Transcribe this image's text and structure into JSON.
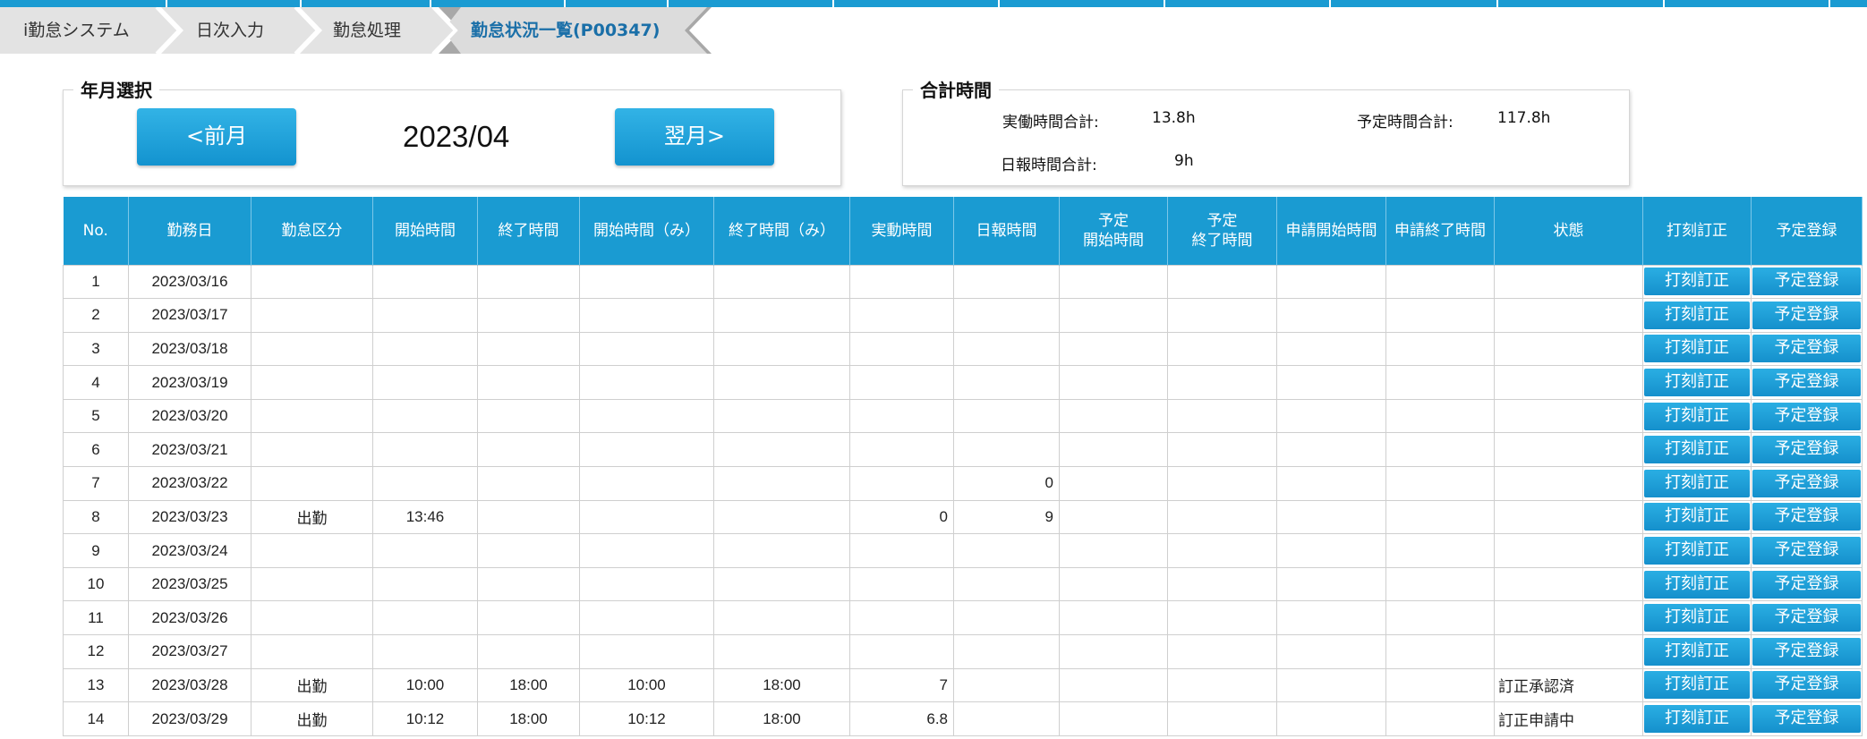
{
  "breadcrumb": {
    "items": [
      "i勤怠システム",
      "日次入力",
      "勤怠処理",
      "勤怠状況一覧(P00347)"
    ]
  },
  "month_panel": {
    "legend": "年月選択",
    "prev_label": "<前月",
    "next_label": "翌月>",
    "current": "2023/04"
  },
  "total_panel": {
    "legend": "合計時間",
    "actual_label": "実働時間合計:",
    "actual_value": "13.8h",
    "planned_label": "予定時間合計:",
    "planned_value": "117.8h",
    "report_label": "日報時間合計:",
    "report_value": "9h"
  },
  "table": {
    "headers": [
      "No.",
      "勤務日",
      "勤怠区分",
      "開始時間",
      "終了時間",
      "開始時間（み）",
      "終了時間（み）",
      "実動時間",
      "日報時間",
      "予定\n開始時間",
      "予定\n終了時間",
      "申請開始時間",
      "申請終了時間",
      "状態",
      "打刻訂正",
      "予定登録"
    ],
    "button_correct": "打刻訂正",
    "button_plan": "予定登録",
    "rows": [
      {
        "no": "1",
        "date": "2023/03/16",
        "kubun": "",
        "start": "",
        "end": "",
        "start_m": "",
        "end_m": "",
        "actual": "",
        "report": "",
        "plan_start": "",
        "plan_end": "",
        "req_start": "",
        "req_end": "",
        "status": ""
      },
      {
        "no": "2",
        "date": "2023/03/17",
        "kubun": "",
        "start": "",
        "end": "",
        "start_m": "",
        "end_m": "",
        "actual": "",
        "report": "",
        "plan_start": "",
        "plan_end": "",
        "req_start": "",
        "req_end": "",
        "status": ""
      },
      {
        "no": "3",
        "date": "2023/03/18",
        "kubun": "",
        "start": "",
        "end": "",
        "start_m": "",
        "end_m": "",
        "actual": "",
        "report": "",
        "plan_start": "",
        "plan_end": "",
        "req_start": "",
        "req_end": "",
        "status": ""
      },
      {
        "no": "4",
        "date": "2023/03/19",
        "kubun": "",
        "start": "",
        "end": "",
        "start_m": "",
        "end_m": "",
        "actual": "",
        "report": "",
        "plan_start": "",
        "plan_end": "",
        "req_start": "",
        "req_end": "",
        "status": ""
      },
      {
        "no": "5",
        "date": "2023/03/20",
        "kubun": "",
        "start": "",
        "end": "",
        "start_m": "",
        "end_m": "",
        "actual": "",
        "report": "",
        "plan_start": "",
        "plan_end": "",
        "req_start": "",
        "req_end": "",
        "status": ""
      },
      {
        "no": "6",
        "date": "2023/03/21",
        "kubun": "",
        "start": "",
        "end": "",
        "start_m": "",
        "end_m": "",
        "actual": "",
        "report": "",
        "plan_start": "",
        "plan_end": "",
        "req_start": "",
        "req_end": "",
        "status": ""
      },
      {
        "no": "7",
        "date": "2023/03/22",
        "kubun": "",
        "start": "",
        "end": "",
        "start_m": "",
        "end_m": "",
        "actual": "",
        "report": "0",
        "plan_start": "",
        "plan_end": "",
        "req_start": "",
        "req_end": "",
        "status": ""
      },
      {
        "no": "8",
        "date": "2023/03/23",
        "kubun": "出勤",
        "start": "13:46",
        "end": "",
        "start_m": "",
        "end_m": "",
        "actual": "0",
        "report": "9",
        "plan_start": "",
        "plan_end": "",
        "req_start": "",
        "req_end": "",
        "status": ""
      },
      {
        "no": "9",
        "date": "2023/03/24",
        "kubun": "",
        "start": "",
        "end": "",
        "start_m": "",
        "end_m": "",
        "actual": "",
        "report": "",
        "plan_start": "",
        "plan_end": "",
        "req_start": "",
        "req_end": "",
        "status": ""
      },
      {
        "no": "10",
        "date": "2023/03/25",
        "kubun": "",
        "start": "",
        "end": "",
        "start_m": "",
        "end_m": "",
        "actual": "",
        "report": "",
        "plan_start": "",
        "plan_end": "",
        "req_start": "",
        "req_end": "",
        "status": ""
      },
      {
        "no": "11",
        "date": "2023/03/26",
        "kubun": "",
        "start": "",
        "end": "",
        "start_m": "",
        "end_m": "",
        "actual": "",
        "report": "",
        "plan_start": "",
        "plan_end": "",
        "req_start": "",
        "req_end": "",
        "status": ""
      },
      {
        "no": "12",
        "date": "2023/03/27",
        "kubun": "",
        "start": "",
        "end": "",
        "start_m": "",
        "end_m": "",
        "actual": "",
        "report": "",
        "plan_start": "",
        "plan_end": "",
        "req_start": "",
        "req_end": "",
        "status": ""
      },
      {
        "no": "13",
        "date": "2023/03/28",
        "kubun": "出勤",
        "start": "10:00",
        "end": "18:00",
        "start_m": "10:00",
        "end_m": "18:00",
        "actual": "7",
        "report": "",
        "plan_start": "",
        "plan_end": "",
        "req_start": "",
        "req_end": "",
        "status": "訂正承認済"
      },
      {
        "no": "14",
        "date": "2023/03/29",
        "kubun": "出勤",
        "start": "10:12",
        "end": "18:00",
        "start_m": "10:12",
        "end_m": "18:00",
        "actual": "6.8",
        "report": "",
        "plan_start": "",
        "plan_end": "",
        "req_start": "",
        "req_end": "",
        "status": "訂正申請中"
      }
    ]
  }
}
